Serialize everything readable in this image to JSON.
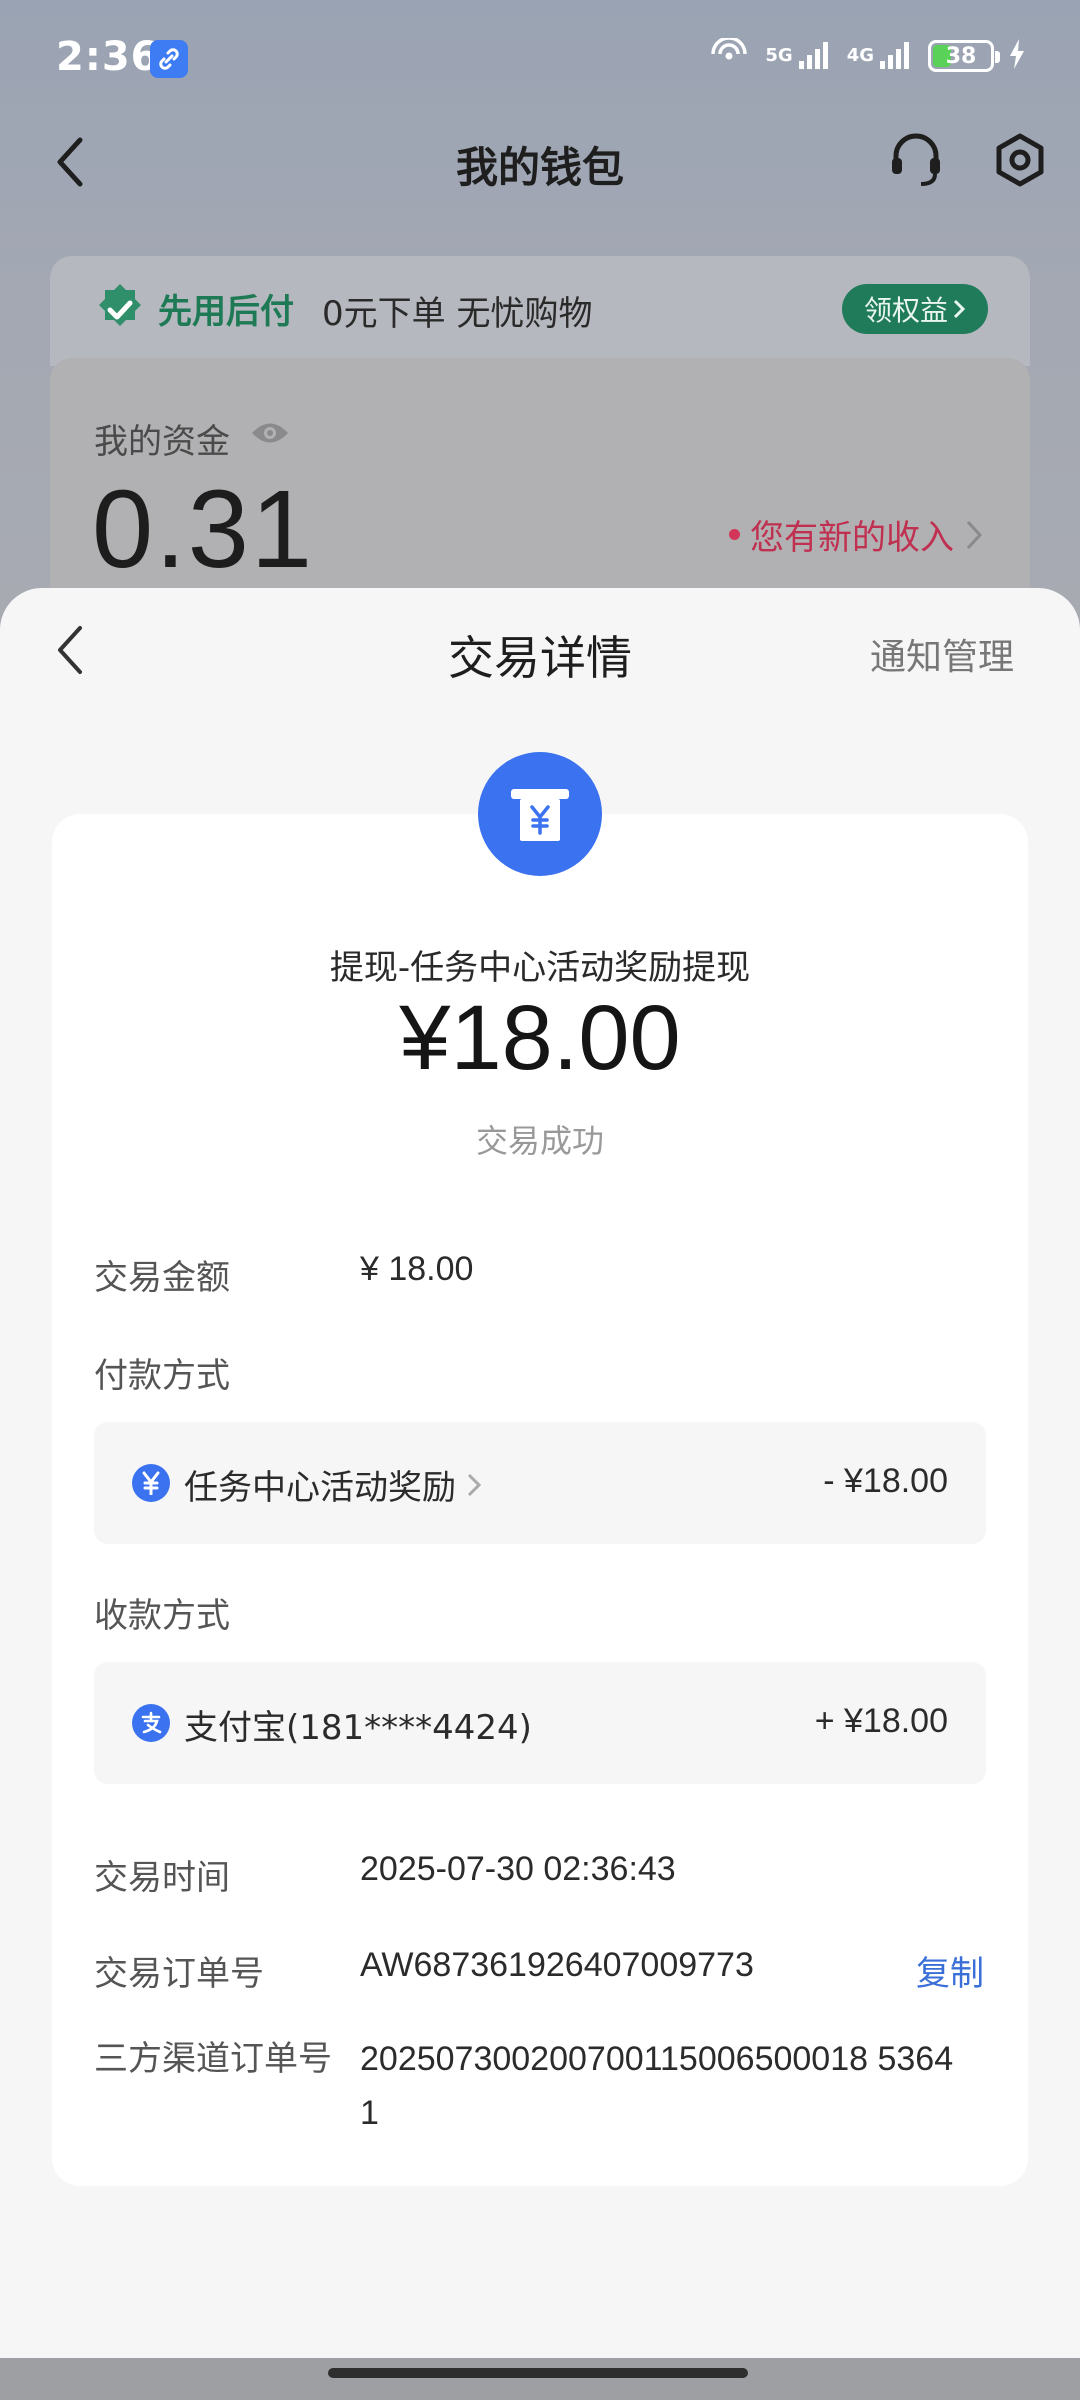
{
  "status_bar": {
    "time": "2:36",
    "net1": "5G",
    "net2": "4G",
    "battery": "38"
  },
  "wallet": {
    "title": "我的钱包",
    "promo": {
      "brand": "先用后付",
      "slogan": "0元下单 无忧购物",
      "claim": "领权益"
    },
    "funds": {
      "label": "我的资金",
      "amount": "0.31",
      "income_notice": "您有新的收入"
    }
  },
  "sheet": {
    "title": "交易详情",
    "notify_manage": "通知管理",
    "tx_name": "提现-任务中心活动奖励提现",
    "tx_amount": "¥18.00",
    "tx_status": "交易成功",
    "rows": {
      "amount_label": "交易金额",
      "amount_value": "¥ 18.00",
      "pay_label": "付款方式",
      "pay_method": "任务中心活动奖励",
      "pay_amount": "- ¥18.00",
      "recv_label": "收款方式",
      "recv_method": "支付宝(181****4424)",
      "recv_amount": "+ ¥18.00",
      "time_label": "交易时间",
      "time_value": "2025-07-30 02:36:43",
      "order_label": "交易订单号",
      "order_value": "AW687361926407009773",
      "copy": "复制",
      "channel_label": "三方渠道订单号",
      "channel_value": "202507300200700115006500018 53641"
    }
  },
  "colors": {
    "brand_green": "#1f7b5a",
    "accent_blue": "#3a72f0",
    "income_red": "#c03050"
  }
}
